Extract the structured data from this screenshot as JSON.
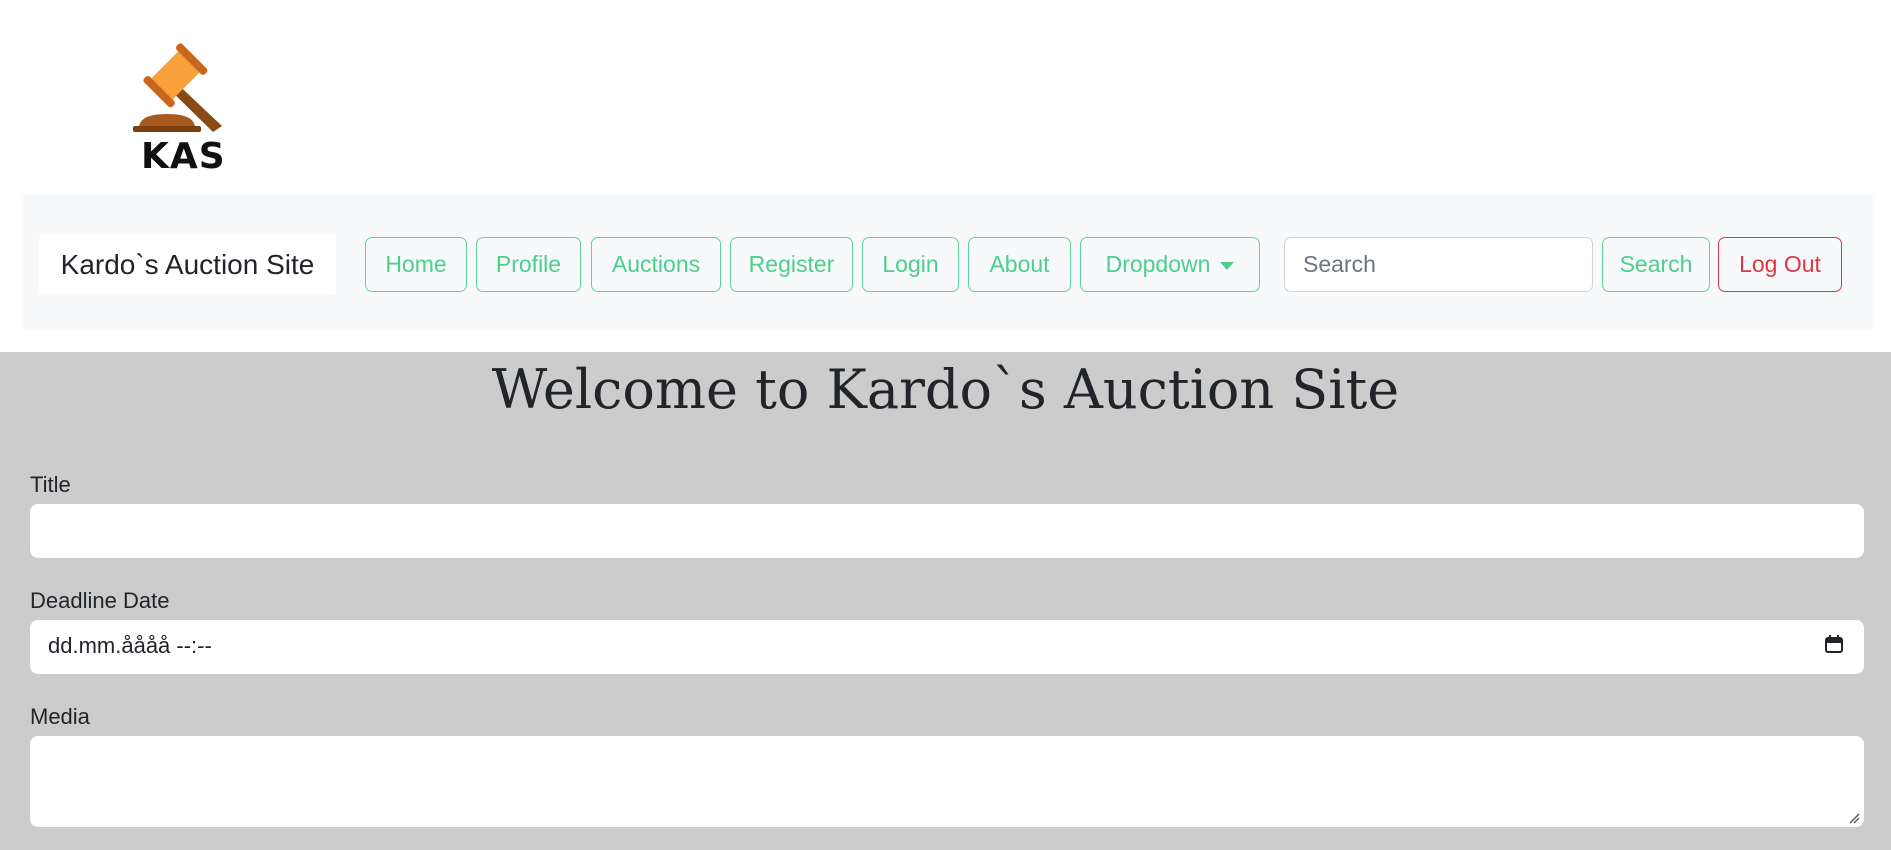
{
  "logo": {
    "text": "KAS"
  },
  "navbar": {
    "brand": "Kardo`s Auction Site",
    "items": [
      {
        "label": "Home"
      },
      {
        "label": "Profile"
      },
      {
        "label": "Auctions"
      },
      {
        "label": "Register"
      },
      {
        "label": "Login"
      },
      {
        "label": "About"
      }
    ],
    "dropdown_label": "Dropdown",
    "search_placeholder": "Search",
    "search_button": "Search",
    "logout_button": "Log Out"
  },
  "main": {
    "title": "Welcome to Kardo`s Auction Site",
    "form": {
      "title_label": "Title",
      "title_value": "",
      "deadline_label": "Deadline Date",
      "deadline_value": "dd.mm.åååå --:--",
      "media_label": "Media",
      "media_value": ""
    }
  },
  "colors": {
    "accent": "#4ccf8d",
    "danger": "#dc3545",
    "nav_bg": "#f8f9fa",
    "main_bg": "#cccccc"
  }
}
